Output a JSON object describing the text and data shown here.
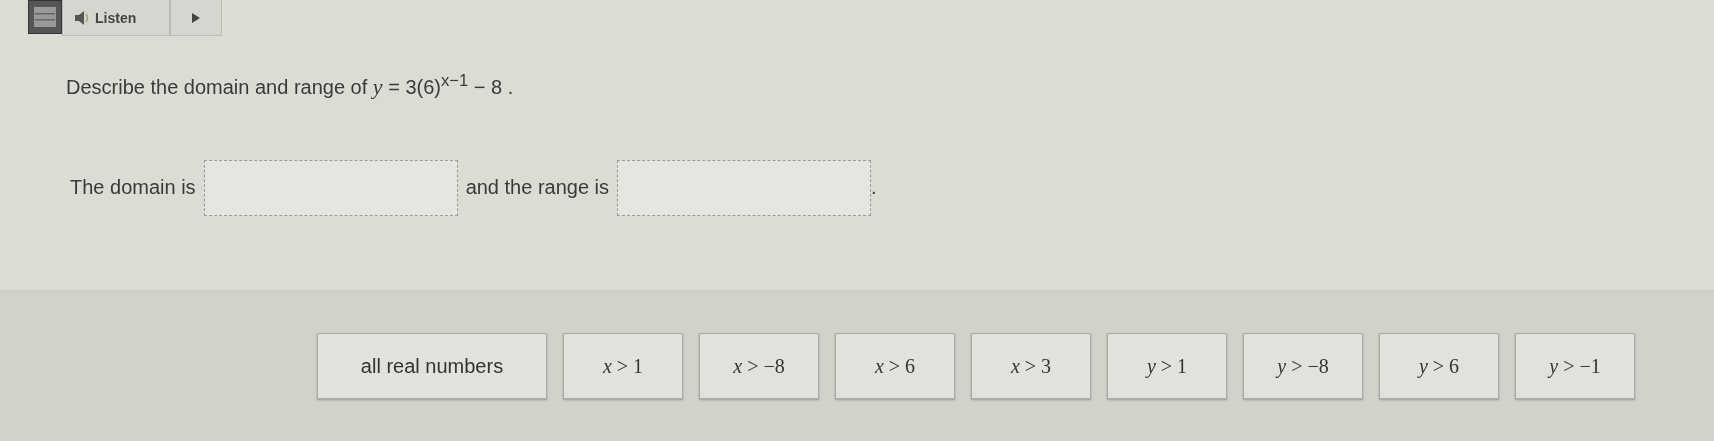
{
  "toolbar": {
    "listen_label": "Listen"
  },
  "question": "Describe the domain and range of *y* = 3(6)$^{x−1}$ − 8 .",
  "sentence": [
    {
      "kind": "text",
      "text": "The domain is"
    },
    {
      "kind": "blank"
    },
    {
      "kind": "text",
      "text": "and the range is"
    },
    {
      "kind": "blank"
    },
    {
      "kind": "text",
      "text": "."
    }
  ],
  "options": [
    "all real numbers",
    "*x* > 1",
    "*x* > −8",
    "*x* > 6",
    "*x* > 3",
    "*y* > 1",
    "*y* > −8",
    "*y* > 6",
    "*y* > −1"
  ]
}
